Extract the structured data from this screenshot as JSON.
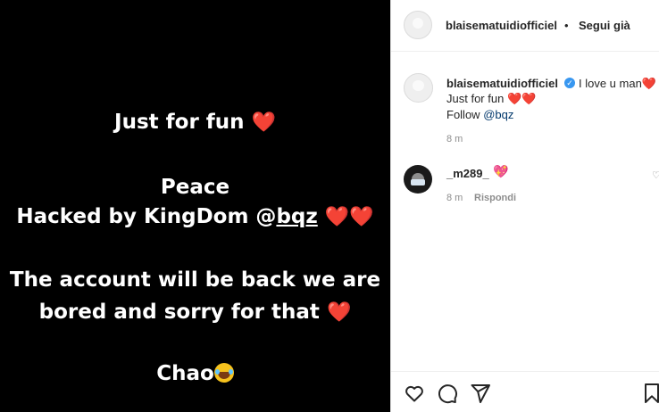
{
  "media": {
    "line1": "Just for fun",
    "line2": "Peace",
    "line3_prefix": "Hacked by KingDom @",
    "line3_mention": "bqz",
    "line4": "The account will be back we are",
    "line5": "bored and sorry for that",
    "line6": "Chao",
    "heart": "❤️"
  },
  "header": {
    "username": "blaisematuidiofficiel",
    "separator": "•",
    "follow_label": "Segui già"
  },
  "caption": {
    "username": "blaisematuidiofficiel",
    "text_line1": "I love u man",
    "text_line2": "Just for fun",
    "follow_prefix": "Follow ",
    "mention": "@bqz",
    "time": "8 m",
    "heart": "❤️"
  },
  "comment": {
    "username": "_m289_",
    "emoji": "💖",
    "time": "8 m",
    "reply_label": "Rispondi"
  },
  "icons": {
    "like": "heart-icon",
    "comment": "comment-icon",
    "share": "paper-plane-icon",
    "save": "bookmark-icon",
    "verified": "verified-badge-icon"
  },
  "colors": {
    "media_bg": "#000000",
    "heart": "#ed4956",
    "verified": "#3897f0",
    "mention": "#00376b",
    "muted": "#8e8e8e"
  }
}
